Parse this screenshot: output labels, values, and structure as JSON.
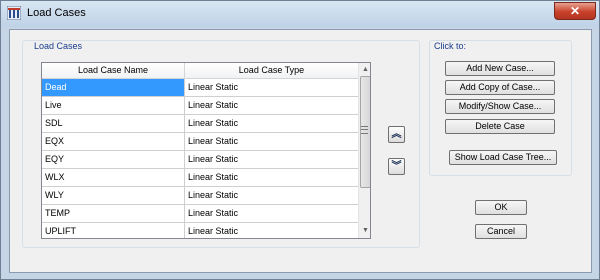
{
  "window": {
    "title": "Load Cases",
    "close_glyph": "✕"
  },
  "load_cases_group": {
    "title": "Load Cases",
    "columns": [
      "Load Case Name",
      "Load Case Type"
    ],
    "rows": [
      {
        "name": "Dead",
        "type": "Linear Static",
        "selected": true
      },
      {
        "name": "Live",
        "type": "Linear Static",
        "selected": false
      },
      {
        "name": "SDL",
        "type": "Linear Static",
        "selected": false
      },
      {
        "name": "EQX",
        "type": "Linear Static",
        "selected": false
      },
      {
        "name": "EQY",
        "type": "Linear Static",
        "selected": false
      },
      {
        "name": "WLX",
        "type": "Linear Static",
        "selected": false
      },
      {
        "name": "WLY",
        "type": "Linear Static",
        "selected": false
      },
      {
        "name": "TEMP",
        "type": "Linear Static",
        "selected": false
      },
      {
        "name": "UPLIFT",
        "type": "Linear Static",
        "selected": false
      }
    ],
    "move_up_glyph": "︽",
    "move_down_glyph": "︾"
  },
  "actions": {
    "title": "Click to:",
    "add_new": "Add New Case...",
    "add_copy": "Add Copy of Case...",
    "modify_show": "Modify/Show Case...",
    "delete": "Delete Case",
    "show_tree": "Show Load Case Tree..."
  },
  "footer": {
    "ok": "OK",
    "cancel": "Cancel"
  },
  "colors": {
    "selection": "#3399ff",
    "group_title": "#1a3b8c",
    "close_button": "#c8412b"
  }
}
